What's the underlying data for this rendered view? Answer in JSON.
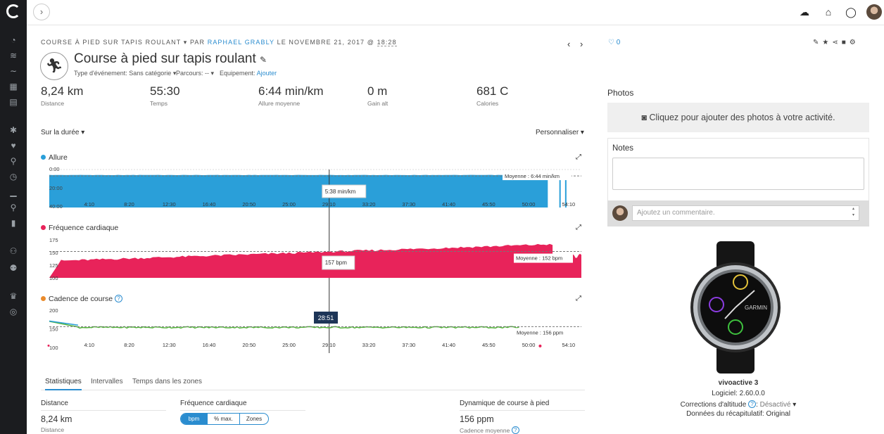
{
  "activity": {
    "meta_prefix": "COURSE À PIED SUR TAPIS ROULANT",
    "meta_by": "PAR",
    "author": "RAPHAEL GRABLY",
    "meta_date": "LE NOVEMBRE 21, 2017 @",
    "time": "18:28",
    "title": "Course à pied sur tapis roulant",
    "event_type": "Type d'événement: Sans catégorie",
    "course": "Parcours: --",
    "equipment_label": "Equipement:",
    "equipment_link": "Ajouter",
    "likes": "0"
  },
  "stats": [
    {
      "value": "8,24 km",
      "label": "Distance"
    },
    {
      "value": "55:30",
      "label": "Temps"
    },
    {
      "value": "6:44 min/km",
      "label": "Allure moyenne"
    },
    {
      "value": "0 m",
      "label": "Gain alt"
    },
    {
      "value": "681 C",
      "label": "Calories"
    }
  ],
  "controls": {
    "duration": "Sur la durée",
    "customize": "Personnaliser"
  },
  "colors": {
    "pace": "#2a9fd9",
    "heart": "#e8235a",
    "cadence_green": "#53b33a",
    "cadence_orange": "#ea8b2b",
    "accent": "#2a8ccf"
  },
  "chart_data": [
    {
      "type": "area",
      "title": "Allure",
      "y_ticks": [
        "0:00",
        "20:00",
        "40:00"
      ],
      "x_ticks": [
        "4:10",
        "8:20",
        "12:30",
        "16:40",
        "20:50",
        "25:00",
        "29:10",
        "33:20",
        "37:30",
        "41:40",
        "45:50",
        "50:00",
        "54:10"
      ],
      "x_range_min": [
        0,
        55.5
      ],
      "y_range_min_per_km": [
        0,
        40
      ],
      "avg_label": "Moyenne : 6:44 min/km",
      "cursor_label": "5:38 min/km",
      "cursor_time_min": 29.2
    },
    {
      "type": "area",
      "title": "Fréquence cardiaque",
      "y_ticks": [
        "175",
        "150",
        "125",
        "100"
      ],
      "avg_label": "Moyenne : 152 bpm",
      "cursor_label": "157 bpm",
      "y_range_bpm": [
        100,
        175
      ],
      "cursor_time_min": 29.2
    },
    {
      "type": "line",
      "title": "Cadence de course",
      "y_ticks": [
        "200",
        "150",
        "100"
      ],
      "x_ticks": [
        "4:10",
        "8:20",
        "12:30",
        "16:40",
        "20:50",
        "25:00",
        "29:10",
        "33:20",
        "37:30",
        "41:40",
        "45:50",
        "50:00",
        "54:10"
      ],
      "avg_label": "Moyenne : 156 ppm",
      "cursor_time": "28:51",
      "y_range_ppm": [
        100,
        200
      ],
      "cursor_time_min": 28.85
    }
  ],
  "tabs": [
    "Statistiques",
    "Intervalles",
    "Temps dans les zones"
  ],
  "summary": {
    "distance_head": "Distance",
    "distance_value": "8,24 km",
    "distance_label": "Distance",
    "hr_head": "Fréquence cardiaque",
    "hr_modes": [
      "bpm",
      "% max.",
      "Zones"
    ],
    "dyn_head": "Dynamique de course à pied",
    "cadence_value": "156 ppm",
    "cadence_label": "Cadence moyenne"
  },
  "right": {
    "photos_title": "Photos",
    "photos_cta": "Cliquez pour ajouter des photos à votre activité.",
    "notes_title": "Notes",
    "comment_placeholder": "Ajoutez un commentaire.",
    "device_name": "vivoactive 3",
    "software": "Logiciel: 2.60.0.0",
    "altitude_label": "Corrections d'altitude",
    "altitude_value": "Désactivé",
    "summary_data": "Données du récapitulatif: Original",
    "watch_brand": "GARMIN"
  }
}
